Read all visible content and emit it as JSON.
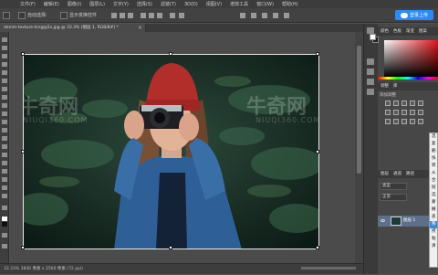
{
  "menubar": {
    "items": [
      "文件(F)",
      "编辑(E)",
      "图像(I)",
      "图层(L)",
      "文字(Y)",
      "选择(S)",
      "滤镜(T)",
      "3D(D)",
      "视图(V)",
      "增效工具",
      "窗口(W)",
      "帮助(H)"
    ]
  },
  "options_bar": {
    "auto_select_label": "自动选择:",
    "show_transform_label": "显示变换控件",
    "login_label": "登录上传"
  },
  "document": {
    "tab_title": "denim-texture-king@2x.jpg @ 33.3% (图层 1, RGB/8#) *",
    "close_glyph": "×"
  },
  "status_bar": {
    "text": "33.33%   3840 像素 x 2560 像素 (72 ppi)"
  },
  "panels": {
    "color_tabs": [
      "颜色",
      "色板",
      "渐变",
      "图案"
    ],
    "adjust_tabs": [
      "调整",
      "库"
    ],
    "adjust_title": "添加调整",
    "layers_tabs": [
      "图层",
      "通道",
      "路径"
    ],
    "layer_kind": "类型",
    "layer_mode": "正常",
    "layer_name": "图层 1"
  },
  "context_menu": {
    "items": [
      "混",
      "复",
      "删",
      "快",
      "转",
      "从",
      "合",
      "链",
      "选",
      "蒙",
      "栅",
      "盖",
      "释",
      "拷",
      "粘",
      "清"
    ],
    "highlighted_index": 12
  },
  "watermarks": {
    "left_main": "牛奇网",
    "left_sub": "NIUQI360.COM",
    "right_main": "牛奇网",
    "right_sub": "NIUQI360.COM"
  },
  "colors": {
    "accent": "#2a8af6",
    "foreground": "#ffffff",
    "background": "#1e1e1e"
  }
}
